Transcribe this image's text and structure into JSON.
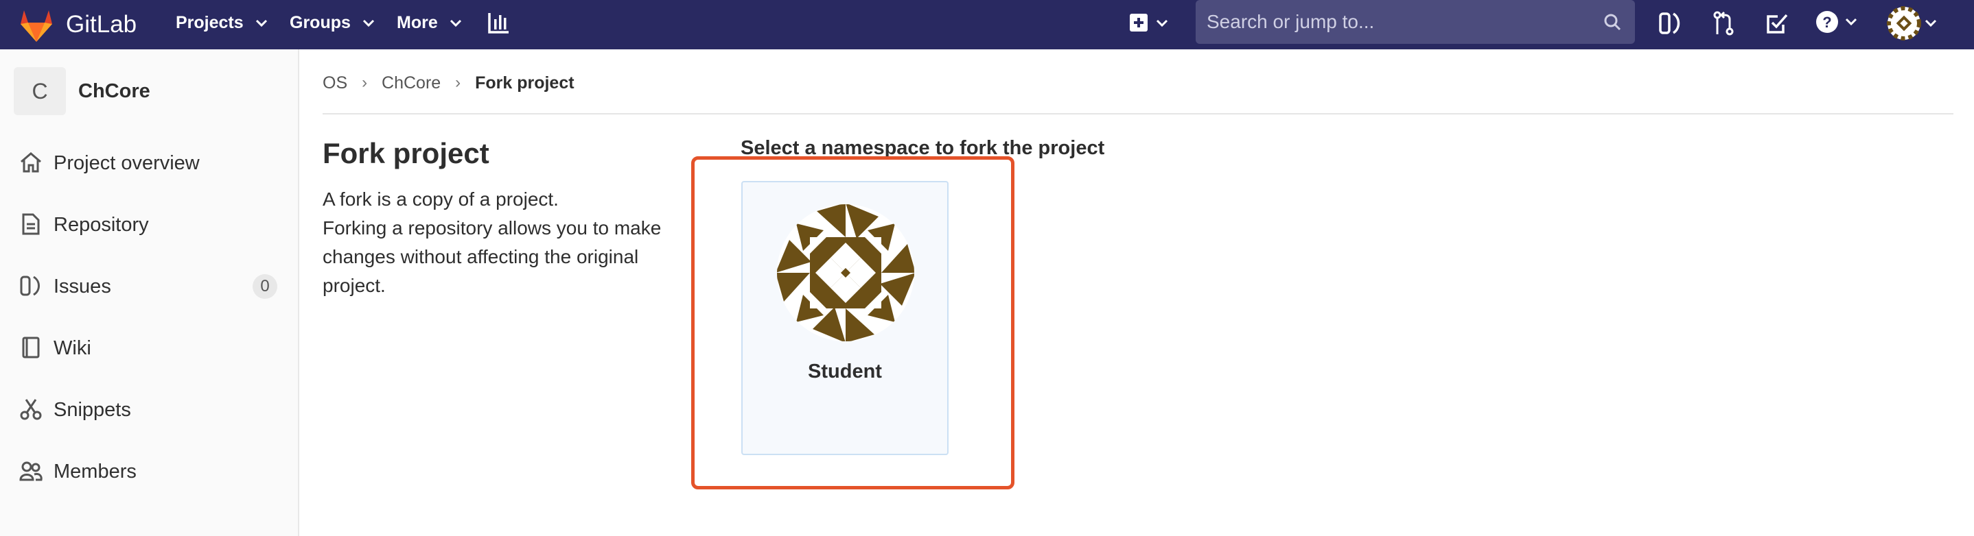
{
  "navbar": {
    "brand": "GitLab",
    "projects_label": "Projects",
    "groups_label": "Groups",
    "more_label": "More",
    "search_placeholder": "Search or jump to...",
    "bg_color": "#292961",
    "icons": [
      "gitlab-logo",
      "chevron-down-icon",
      "activity-chart-icon",
      "plus-square-icon",
      "search-icon",
      "issues-icon",
      "merge-request-icon",
      "todo-check-icon",
      "help-icon",
      "user-avatar"
    ]
  },
  "sidebar": {
    "project_initial": "C",
    "project_name": "ChCore",
    "items": [
      {
        "label": "Project overview",
        "icon": "home-icon"
      },
      {
        "label": "Repository",
        "icon": "document-icon"
      },
      {
        "label": "Issues",
        "icon": "issues-icon",
        "count": "0"
      },
      {
        "label": "Wiki",
        "icon": "book-icon"
      },
      {
        "label": "Snippets",
        "icon": "scissors-icon"
      },
      {
        "label": "Members",
        "icon": "users-icon"
      }
    ]
  },
  "breadcrumb": {
    "items": [
      "OS",
      "ChCore",
      "Fork project"
    ]
  },
  "main": {
    "title": "Fork project",
    "description_line1": "A fork is a copy of a project.",
    "description_line2": "Forking a repository allows you to make changes without affecting the original project.",
    "namespace_heading": "Select a namespace to fork the project",
    "namespaces": [
      {
        "name": "Student",
        "avatar_color": "#6b4f16"
      }
    ]
  },
  "highlight_color": "#e4532a"
}
